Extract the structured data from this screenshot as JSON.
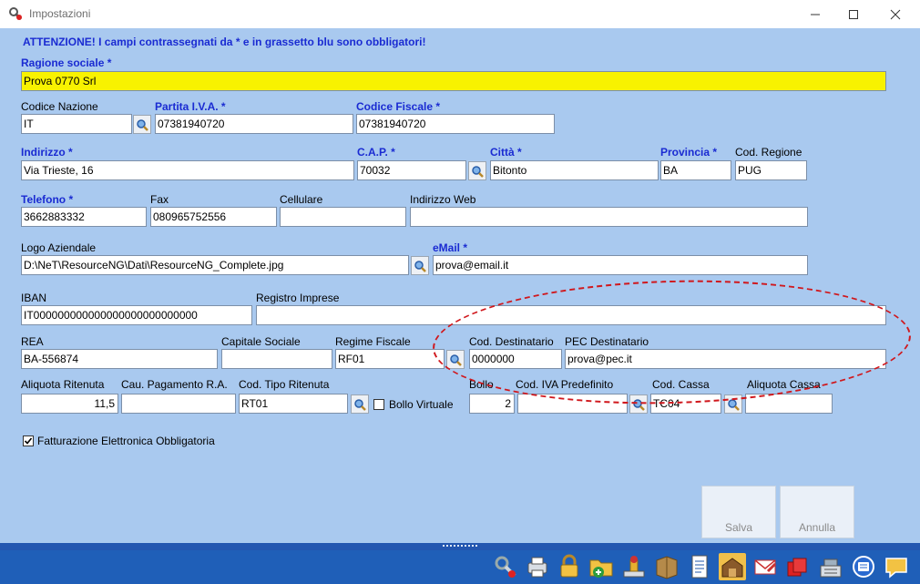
{
  "window": {
    "title": "Impostazioni"
  },
  "warning": "ATTENZIONE! I campi contrassegnati da * e in grassetto blu sono obbligatori!",
  "labels": {
    "ragione_sociale": "Ragione sociale *",
    "codice_nazione": "Codice Nazione",
    "partita_iva": "Partita I.V.A. *",
    "codice_fiscale": "Codice Fiscale *",
    "indirizzo": "Indirizzo *",
    "cap": "C.A.P. *",
    "citta": "Città *",
    "provincia": "Provincia *",
    "cod_regione": "Cod. Regione",
    "telefono": "Telefono *",
    "fax": "Fax",
    "cellulare": "Cellulare",
    "indirizzo_web": "Indirizzo Web",
    "logo": "Logo Aziendale",
    "email": "eMail *",
    "iban": "IBAN",
    "registro_imprese": "Registro Imprese",
    "rea": "REA",
    "capitale_sociale": "Capitale Sociale",
    "regime_fiscale": "Regime Fiscale",
    "cod_destinatario": "Cod. Destinatario",
    "pec_destinatario": "PEC Destinatario",
    "aliquota_ritenuta": "Aliquota Ritenuta",
    "cau_pagamento": "Cau. Pagamento R.A.",
    "cod_tipo_ritenuta": "Cod. Tipo Ritenuta",
    "bollo_virtuale": "Bollo Virtuale",
    "bollo": "Bollo",
    "cod_iva_predefinito": "Cod. IVA Predefinito",
    "cod_cassa": "Cod. Cassa",
    "aliquota_cassa": "Aliquota Cassa",
    "fatturazione_elettronica": "Fatturazione Elettronica Obbligatoria"
  },
  "values": {
    "ragione_sociale": "Prova 0770 Srl",
    "codice_nazione": "IT",
    "partita_iva": "07381940720",
    "codice_fiscale": "07381940720",
    "indirizzo": "Via Trieste, 16",
    "cap": "70032",
    "citta": "Bitonto",
    "provincia": "BA",
    "cod_regione": "PUG",
    "telefono": "3662883332",
    "fax": "080965752556",
    "cellulare": "",
    "indirizzo_web": "",
    "logo": "D:\\NeT\\ResourceNG\\Dati\\ResourceNG_Complete.jpg",
    "email": "prova@email.it",
    "iban": "IT000000000000000000000000000",
    "registro_imprese": "",
    "rea": "BA-556874",
    "capitale_sociale": "",
    "regime_fiscale": "RF01",
    "cod_destinatario": "0000000",
    "pec_destinatario": "prova@pec.it",
    "aliquota_ritenuta": "11,5",
    "cau_pagamento": "",
    "cod_tipo_ritenuta": "RT01",
    "bollo_virtuale": false,
    "bollo": "2",
    "cod_iva_predefinito": "",
    "cod_cassa": "TC04",
    "aliquota_cassa": "",
    "fatturazione_elettronica": true
  },
  "buttons": {
    "salva": "Salva",
    "annulla": "Annulla"
  },
  "toolbar_icons": [
    "tools-icon",
    "printer-icon",
    "lock-icon",
    "folder-add-icon",
    "stamp-icon",
    "archive-box-icon",
    "document-icon",
    "warehouse-icon",
    "mail-icon",
    "red-folders-icon",
    "cash-register-icon",
    "network-icon",
    "chat-icon"
  ],
  "colors": {
    "required_label": "#1a2bd2",
    "background": "#a9c9ef",
    "required_field": "#f8f200",
    "highlight_ellipse": "#d0181d",
    "toolbar": "#1f5fb8"
  }
}
